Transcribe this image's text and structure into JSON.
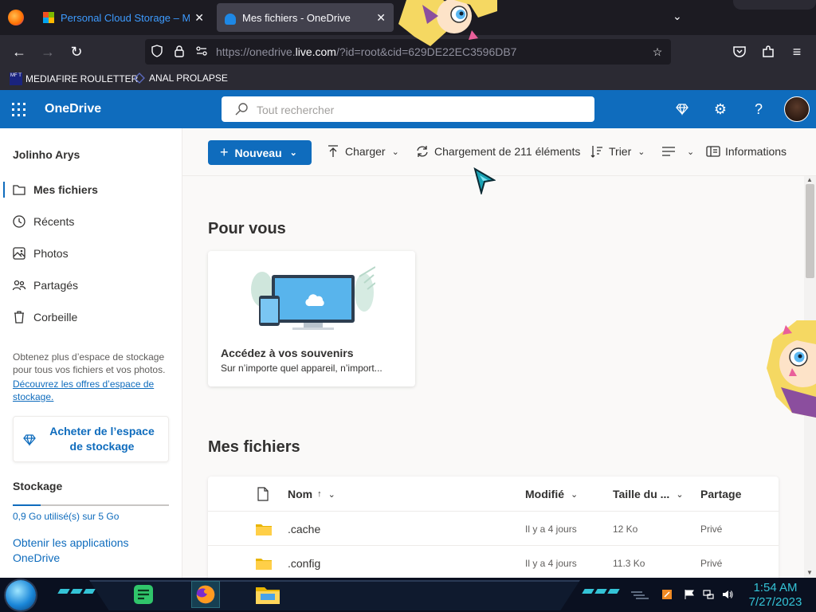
{
  "browser": {
    "tabs": [
      {
        "label": "Personal Cloud Storage – Micros",
        "active": false
      },
      {
        "label": "Mes fichiers - OneDrive",
        "active": true
      }
    ],
    "url_prefix": "https://onedrive.",
    "url_domain": "live.com",
    "url_suffix": "/?id=root&cid=629DE22EC3596DB7",
    "bookmarks": [
      "MEDIAFIRE ROULETTER",
      "ANAL PROLAPSE"
    ],
    "bookmark_icon_text": "MF T"
  },
  "onedrive": {
    "brand": "OneDrive",
    "search_placeholder": "Tout rechercher",
    "accent_color": "#0f6cbd"
  },
  "sidebar": {
    "user_name": "Jolinho Arys",
    "items": [
      {
        "label": "Mes fichiers",
        "icon": "folder-icon",
        "selected": true
      },
      {
        "label": "Récents",
        "icon": "clock-icon"
      },
      {
        "label": "Photos",
        "icon": "image-icon"
      },
      {
        "label": "Partagés",
        "icon": "people-icon"
      },
      {
        "label": "Corbeille",
        "icon": "trash-icon"
      }
    ],
    "promo_text": "Obtenez plus d’espace de stockage pour tous vos fichiers et vos photos.",
    "promo_link": "Découvrez les offres d’espace de stockage.",
    "buy_label": "Acheter de l’espace de stockage",
    "storage_title": "Stockage",
    "storage_used_fraction": 0.18,
    "storage_text": "0,9 Go utilisé(s) sur 5 Go",
    "get_apps": "Obtenir les applications OneDrive"
  },
  "commandbar": {
    "new_label": "Nouveau",
    "upload_label": "Charger",
    "loading_label": "Chargement de 211 éléments",
    "sort_label": "Trier",
    "info_label": "Informations"
  },
  "main": {
    "for_you_title": "Pour vous",
    "card_title": "Accédez à vos souvenirs",
    "card_subtitle": "Sur n’importe quel appareil, n’import...",
    "my_files_title": "Mes fichiers",
    "columns": {
      "name": "Nom",
      "name_sort": "↑",
      "modified": "Modifié",
      "size": "Taille du ...",
      "sharing": "Partage"
    },
    "rows": [
      {
        "name": ".cache",
        "modified": "Il y a 4 jours",
        "size": "12 Ko",
        "sharing": "Privé"
      },
      {
        "name": ".config",
        "modified": "Il y a 4 jours",
        "size": "11.3 Ko",
        "sharing": "Privé"
      }
    ]
  },
  "taskbar": {
    "time": "1:54 AM",
    "date": "7/27/2023"
  }
}
